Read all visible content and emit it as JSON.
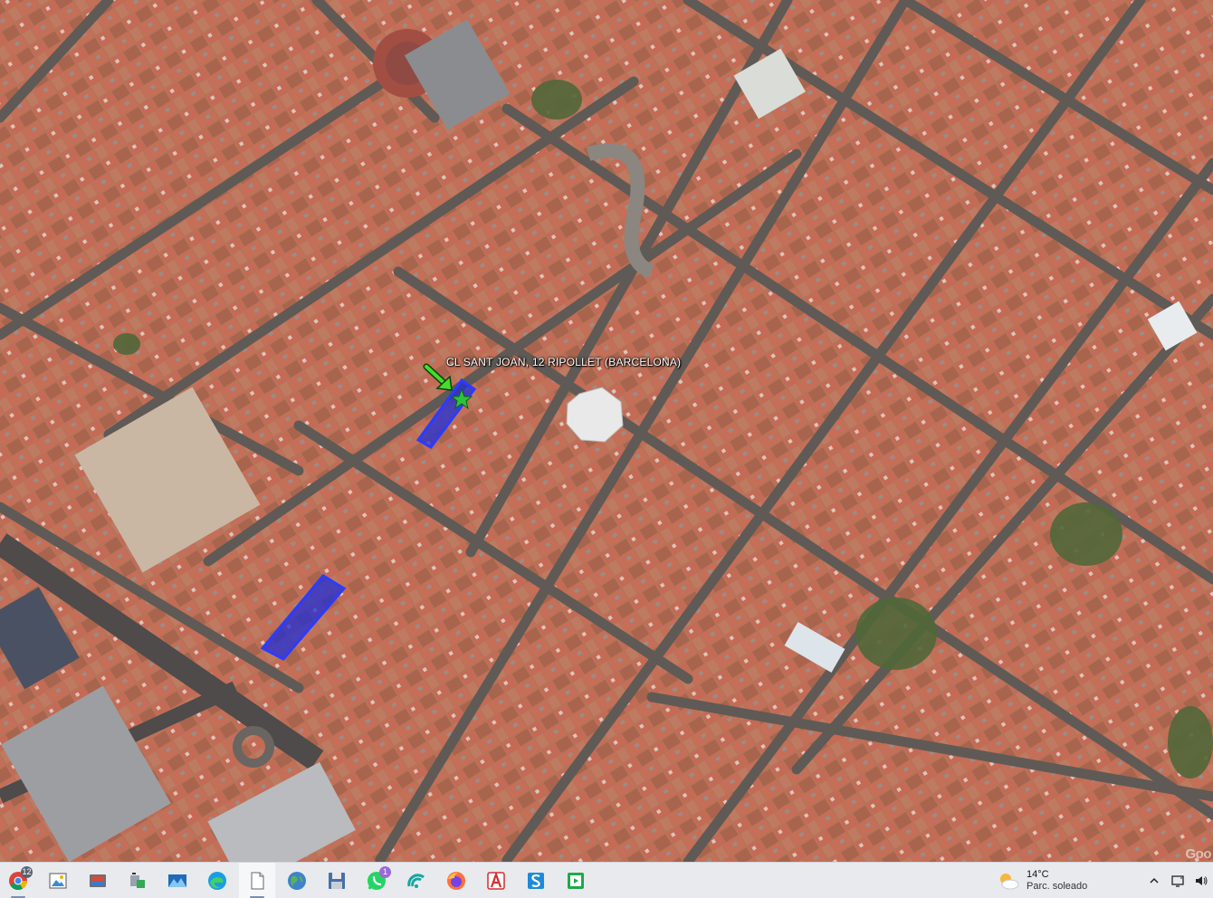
{
  "map": {
    "placemark_label": "CL SANT JOAN, 12  RIPOLLET (BARCELONA)",
    "attribution": "Goo",
    "colors": {
      "roof": "#b9684f",
      "street": "#5a5652",
      "highlight_fill": "#1f2fd8",
      "highlight_stroke": "#2a3cff",
      "arrow": "#3ad12a"
    }
  },
  "taskbar": {
    "apps": [
      {
        "name": "chrome-icon",
        "badge": "12"
      },
      {
        "name": "image-viewer-icon",
        "badge": ""
      },
      {
        "name": "photos-icon",
        "badge": ""
      },
      {
        "name": "network-tool-icon",
        "badge": ""
      },
      {
        "name": "landscape-app-icon",
        "badge": ""
      },
      {
        "name": "edge-icon",
        "badge": ""
      },
      {
        "name": "document-icon",
        "badge": ""
      },
      {
        "name": "globe-icon",
        "badge": ""
      },
      {
        "name": "floppy-save-icon",
        "badge": ""
      },
      {
        "name": "whatsapp-icon",
        "badge": "1"
      },
      {
        "name": "signal-app-icon",
        "badge": ""
      },
      {
        "name": "firefox-icon",
        "badge": ""
      },
      {
        "name": "acrobat-icon",
        "badge": ""
      },
      {
        "name": "s-app-icon",
        "badge": ""
      },
      {
        "name": "media-player-icon",
        "badge": ""
      }
    ],
    "weather": {
      "temp": "14°C",
      "condition": "Parc. soleado"
    }
  }
}
